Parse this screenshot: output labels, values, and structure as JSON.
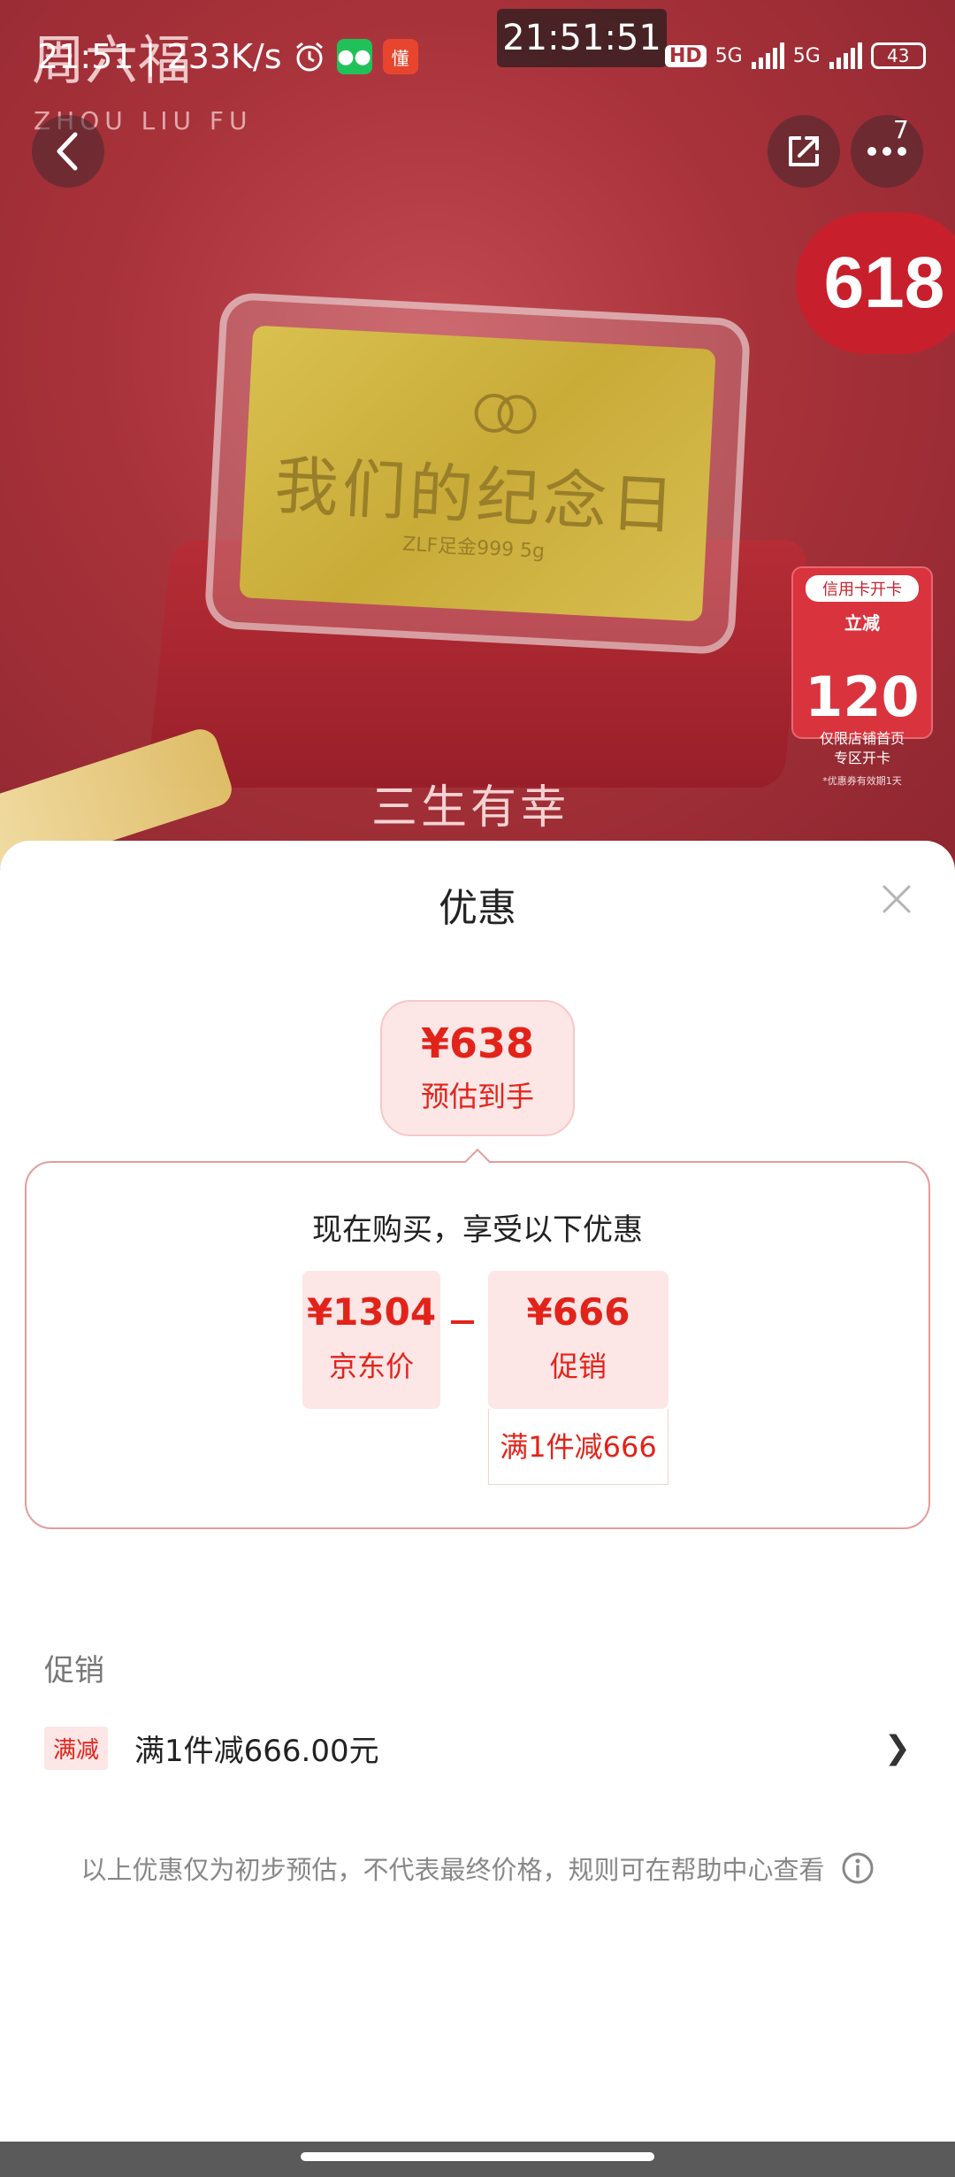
{
  "status_bar": {
    "time_network": "21:51 | 233K/s",
    "clock": "21:51:51",
    "hd_label": "HD",
    "net_1": "5G",
    "net_2": "5G",
    "battery": "43",
    "app_icon_text": "懂"
  },
  "hero": {
    "brand": "周六福",
    "brand_en": "ZHOU LIU FU",
    "gold_text": "我们的纪念日",
    "gold_sub": "ZLF足金999 5g",
    "slogan": "三生有幸",
    "badge_618": "618",
    "credit_card": {
      "title": "信用卡开卡",
      "prefix": "立减",
      "amount": "120",
      "line1": "仅限店铺首页",
      "line2": "专区开卡",
      "note": "*优惠券有效期1天"
    }
  },
  "nav": {
    "more_badge": "7"
  },
  "sheet": {
    "title": "优惠",
    "estimate": {
      "price": "¥638",
      "label": "预估到手"
    },
    "box_title": "现在购买，享受以下优惠",
    "jd_price": {
      "value": "¥1304",
      "label": "京东价"
    },
    "promo_price": {
      "value": "¥666",
      "label": "促销"
    },
    "promo_note": "满1件减666",
    "section_title": "促销",
    "promo_row": {
      "tag": "满减",
      "text": "满1件减666.00元",
      "chevron": "❯"
    },
    "disclaimer": "以上优惠仅为初步预估，不代表最终价格，规则可在帮助中心查看"
  },
  "colors": {
    "accent": "#e2231a",
    "pink_bg": "#fde6e6",
    "hero_red": "#a8323a"
  },
  "icons": [
    "back-icon",
    "share-icon",
    "more-icon",
    "close-icon",
    "info-icon",
    "alarm-icon",
    "wechat-icon"
  ]
}
